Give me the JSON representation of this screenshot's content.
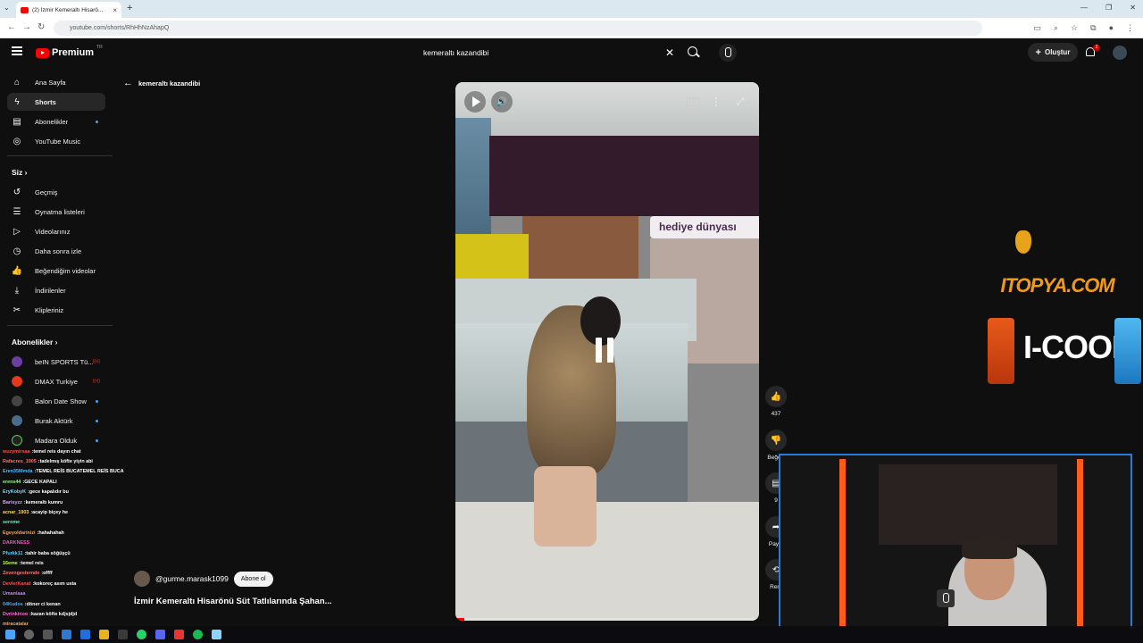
{
  "browser": {
    "tab_title": "(2) İzmir Kemeraltı Hisarö...",
    "url": "youtube.com/shorts/RhHhNzAhapQ"
  },
  "header": {
    "brand": "Premium",
    "brand_region": "TR",
    "search_value": "kemeraltı kazandibi",
    "create_label": "Oluştur",
    "notifications_count": "2"
  },
  "sidebar": {
    "main": [
      {
        "label": "Ana Sayfa",
        "icon": "home-icon"
      },
      {
        "label": "Shorts",
        "icon": "shorts-icon"
      },
      {
        "label": "Abonelikler",
        "icon": "subscriptions-icon"
      },
      {
        "label": "YouTube Music",
        "icon": "music-icon"
      }
    ],
    "you_heading": "Siz",
    "you": [
      {
        "label": "Geçmiş",
        "icon": "history-icon"
      },
      {
        "label": "Oynatma listeleri",
        "icon": "playlists-icon"
      },
      {
        "label": "Videolarınız",
        "icon": "your-videos-icon"
      },
      {
        "label": "Daha sonra izle",
        "icon": "watch-later-icon"
      },
      {
        "label": "Beğendiğim videolar",
        "icon": "liked-icon"
      },
      {
        "label": "İndirilenler",
        "icon": "download-icon"
      },
      {
        "label": "Klipleriniz",
        "icon": "clips-icon"
      }
    ],
    "subs_heading": "Abonelikler",
    "subscriptions": [
      {
        "label": "beIN SPORTS Tü...",
        "color": "#6b3fa0"
      },
      {
        "label": "DMAX Turkiye",
        "color": "#e8381c"
      },
      {
        "label": "Balon Date Show",
        "color": "#444444"
      },
      {
        "label": "Burak Aktürk",
        "color": "#4a6a8a"
      },
      {
        "label": "Madara Olduk",
        "color": "#222222"
      }
    ]
  },
  "back_label": "kemeraltı kazandibi",
  "short": {
    "channel": "@gurme.marask1099",
    "subscribe_label": "Abone ol",
    "title": "İzmir Kemeraltı Hisarönü Süt Tatlılarında Şahan...",
    "shop_sign": "hediye dünyası",
    "likes": "437",
    "dislike_label": "Beğe",
    "comments": "9",
    "share_label": "Payla",
    "remix_label": "Rem",
    "progress": 0.03
  },
  "ads": {
    "itopya": "ITOPYA.COM",
    "icool": "I-COOL"
  },
  "chat": [
    {
      "user": "wuzymirsaa",
      "msg": "temel reis dayın chat",
      "color": "#ff4d4d"
    },
    {
      "user": "Rafacres_1905",
      "msg": "tadelmış köfte yiyin abi",
      "color": "#ff6a6a"
    },
    {
      "user": "Eren35Mmda",
      "msg": "TEMEL REİS BUCATEMEL REİS BUCA",
      "color": "#4db8ff"
    },
    {
      "user": "erens44",
      "msg": "GECE KAPALI",
      "color": "#8cff8c"
    },
    {
      "user": "EryKobyK",
      "msg": "gece kapalıdır bu",
      "color": "#7ad7ff"
    },
    {
      "user": "Barisyzz",
      "msg": "kemeraltı kumru",
      "color": "#d0a0ff"
    },
    {
      "user": "acnar_1903",
      "msg": "acayip biçey he",
      "color": "#ffd24d"
    },
    {
      "user": "serome",
      "msg": "",
      "color": "#4dffb3"
    },
    {
      "user": "Egeyoldarinizi",
      "msg": "hahahahah",
      "color": "#ff9b4d"
    },
    {
      "user": "DARKNESS",
      "msg": "",
      "color": "#ff4dc4"
    },
    {
      "user": "Pfurkk11",
      "msg": "tahir baba söğüşçü",
      "color": "#4dd2ff"
    },
    {
      "user": "16eme",
      "msg": "temel reis",
      "color": "#b3ff4d"
    },
    {
      "user": "Zevengesternde",
      "msg": "offff",
      "color": "#ff7070"
    },
    {
      "user": "DevlerKanat",
      "msg": "kokoreç asım usta",
      "color": "#ff4d4d"
    },
    {
      "user": "Umaniaaa",
      "msg": "",
      "color": "#c77dff"
    },
    {
      "user": "04Kudos",
      "msg": "döner ci kenan",
      "color": "#4da6ff"
    },
    {
      "user": "Dvrinkinoo",
      "msg": "kazan köfte kdjsjdjd",
      "color": "#ff6ad5"
    },
    {
      "user": "miracatalar",
      "msg": "",
      "color": "#ffa64d"
    }
  ]
}
